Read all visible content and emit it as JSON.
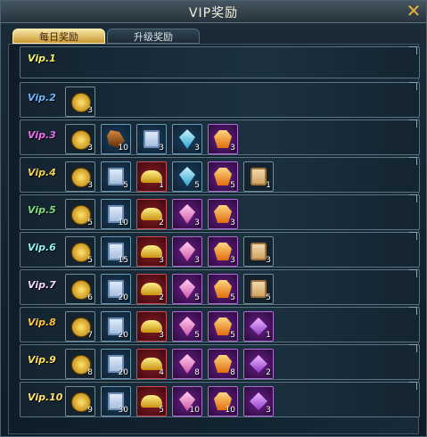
{
  "window": {
    "title": "VIP奖励",
    "close_symbol": "✕"
  },
  "tabs": [
    {
      "label": "每日奖励",
      "active": true
    },
    {
      "label": "升级奖励",
      "active": false
    }
  ],
  "colors": {
    "vip_label_colors": [
      "#f1f16a",
      "#6eb7ff",
      "#f06cf0",
      "#f2d24d",
      "#7ee07e",
      "#8ef5f0",
      "#f3d7ff",
      "#ffc83d",
      "#ffdf5e",
      "#ffe56d"
    ]
  },
  "rows": [
    {
      "vip": "Vip.1",
      "items": []
    },
    {
      "vip": "Vip.2",
      "items": [
        {
          "icon": "gold-coin-icon",
          "qty": "3"
        }
      ]
    },
    {
      "vip": "Vip.3",
      "items": [
        {
          "icon": "gold-coin-icon",
          "qty": "3"
        },
        {
          "icon": "ore-icon",
          "qty": "10"
        },
        {
          "icon": "scroll-sheet-icon",
          "qty": "3"
        },
        {
          "icon": "blue-gem-icon",
          "qty": "3"
        },
        {
          "icon": "orange-gem-icon",
          "qty": "3"
        }
      ]
    },
    {
      "vip": "Vip.4",
      "items": [
        {
          "icon": "gold-coin-icon",
          "qty": "3"
        },
        {
          "icon": "scroll-sheet-icon",
          "qty": "5"
        },
        {
          "icon": "gold-ingot-icon",
          "qty": "1"
        },
        {
          "icon": "blue-gem-icon",
          "qty": "5"
        },
        {
          "icon": "orange-gem-icon",
          "qty": "5"
        },
        {
          "icon": "paper-scroll-icon",
          "qty": "1"
        }
      ]
    },
    {
      "vip": "Vip.5",
      "items": [
        {
          "icon": "gold-coin-icon",
          "qty": "5"
        },
        {
          "icon": "scroll-sheet-icon",
          "qty": "10"
        },
        {
          "icon": "gold-ingot-icon",
          "qty": "2"
        },
        {
          "icon": "pink-gem-icon",
          "qty": "3"
        },
        {
          "icon": "orange-gem-icon",
          "qty": "3"
        }
      ]
    },
    {
      "vip": "Vip.6",
      "items": [
        {
          "icon": "gold-coin-icon",
          "qty": "5"
        },
        {
          "icon": "scroll-sheet-icon",
          "qty": "15"
        },
        {
          "icon": "gold-ingot-icon",
          "qty": "3"
        },
        {
          "icon": "pink-gem-icon",
          "qty": "3"
        },
        {
          "icon": "orange-gem-icon",
          "qty": "3"
        },
        {
          "icon": "paper-scroll-icon",
          "qty": "3"
        }
      ]
    },
    {
      "vip": "Vip.7",
      "items": [
        {
          "icon": "gold-coin-icon",
          "qty": "6"
        },
        {
          "icon": "scroll-sheet-icon",
          "qty": "20"
        },
        {
          "icon": "gold-ingot-icon",
          "qty": "2"
        },
        {
          "icon": "pink-gem-icon",
          "qty": "5"
        },
        {
          "icon": "orange-gem-icon",
          "qty": "5"
        },
        {
          "icon": "paper-scroll-icon",
          "qty": "5"
        }
      ]
    },
    {
      "vip": "Vip.8",
      "items": [
        {
          "icon": "gold-coin-icon",
          "qty": "7"
        },
        {
          "icon": "scroll-sheet-icon",
          "qty": "20"
        },
        {
          "icon": "gold-ingot-icon",
          "qty": "3"
        },
        {
          "icon": "pink-gem-icon",
          "qty": "5"
        },
        {
          "icon": "orange-gem-icon",
          "qty": "5"
        },
        {
          "icon": "purple-scroll-icon",
          "qty": "1"
        }
      ]
    },
    {
      "vip": "Vip.9",
      "items": [
        {
          "icon": "gold-coin-icon",
          "qty": "8"
        },
        {
          "icon": "scroll-sheet-icon",
          "qty": "20"
        },
        {
          "icon": "gold-ingot-icon",
          "qty": "4"
        },
        {
          "icon": "pink-gem-icon",
          "qty": "8"
        },
        {
          "icon": "orange-gem-icon",
          "qty": "8"
        },
        {
          "icon": "purple-scroll-icon",
          "qty": "2"
        }
      ]
    },
    {
      "vip": "Vip.10",
      "items": [
        {
          "icon": "gold-coin-icon",
          "qty": "9"
        },
        {
          "icon": "scroll-sheet-icon",
          "qty": "30"
        },
        {
          "icon": "gold-ingot-icon",
          "qty": "5"
        },
        {
          "icon": "pink-gem-icon",
          "qty": "10"
        },
        {
          "icon": "orange-gem-icon",
          "qty": "10"
        },
        {
          "icon": "purple-scroll-icon",
          "qty": "3"
        }
      ]
    }
  ]
}
